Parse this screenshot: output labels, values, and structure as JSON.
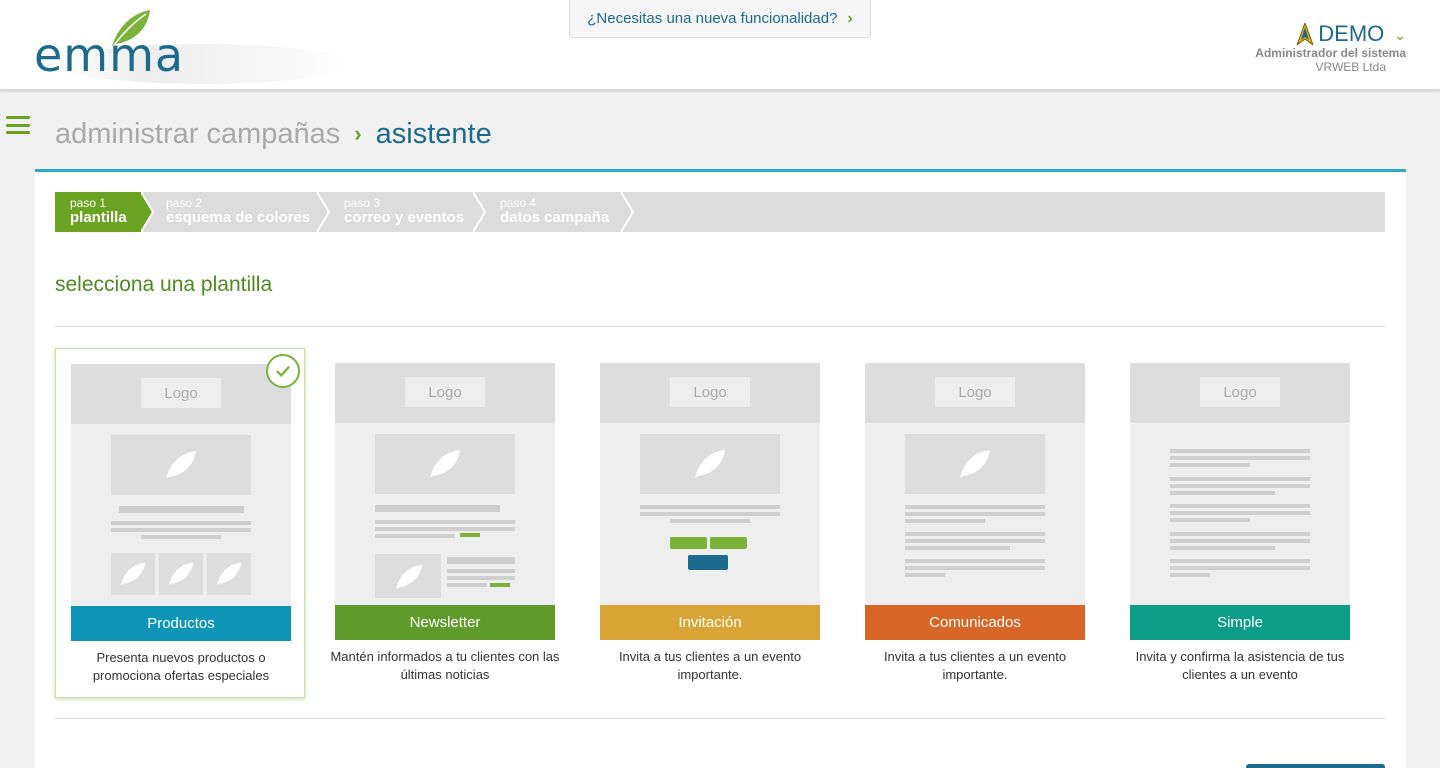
{
  "header": {
    "logo_text": "emma",
    "feature_request": "¿Necesitas una nueva funcionalidad?",
    "user": {
      "name": "DEMO",
      "role": "Administrador del sistema",
      "company": "VRWEB Ltda"
    }
  },
  "breadcrumb": {
    "parent": "administrar campañas",
    "current": "asistente"
  },
  "steps": [
    {
      "num": "paso 1",
      "label": "plantilla",
      "active": true
    },
    {
      "num": "paso 2",
      "label": "esquema de colores",
      "active": false
    },
    {
      "num": "paso 3",
      "label": "correo y eventos",
      "active": false
    },
    {
      "num": "paso 4",
      "label": "datos campaña",
      "active": false
    }
  ],
  "section_title": "selecciona una plantilla",
  "templates": [
    {
      "logo": "Logo",
      "label": "Productos",
      "description": "Presenta nuevos productos o promociona ofertas especiales",
      "color": "#0f95b8",
      "selected": true
    },
    {
      "logo": "Logo",
      "label": "Newsletter",
      "description": "Mantén informados a tu clientes con las últimas noticias",
      "color": "#5f9b2b",
      "selected": false
    },
    {
      "logo": "Logo",
      "label": "Invitación",
      "description": "Invita a tus clientes a un evento importante.",
      "color": "#d9a436",
      "selected": false
    },
    {
      "logo": "Logo",
      "label": "Comunicados",
      "description": "Invita a tus clientes a un evento importante.",
      "color": "#d66526",
      "selected": false
    },
    {
      "logo": "Logo",
      "label": "Simple",
      "description": "Invita y confirma la asistencia de tus clientes a un evento",
      "color": "#0d9c86",
      "selected": false
    }
  ],
  "colors": {
    "brand_blue": "#1c6b8e",
    "brand_green": "#6aa321",
    "panel_accent": "#2aa9cb",
    "step_active": "#6aa321",
    "step_inactive": "#dcdcdc"
  }
}
